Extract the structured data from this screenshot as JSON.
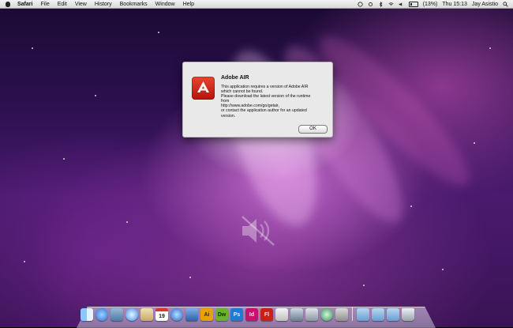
{
  "menubar": {
    "app_name": "Safari",
    "items": [
      "File",
      "Edit",
      "View",
      "History",
      "Bookmarks",
      "Window",
      "Help"
    ],
    "battery_text": "(13%)",
    "clock": "Thu 15:13",
    "user": "Jay Asistio"
  },
  "dialog": {
    "title": "Adobe AIR",
    "message_lines": [
      "This application requires a version of Adobe AIR",
      "which cannot be found.",
      "Please download the latest version of the runtime",
      "from",
      "http://www.adobe.com/go/getair,",
      "or contact the application author for an updated",
      "version."
    ],
    "ok_label": "OK"
  },
  "dock": {
    "calendar_day": "19",
    "app_labels": [
      "Ai",
      "Dw",
      "Ps",
      "Id",
      "Fl"
    ]
  },
  "colors": {
    "adobe_air_red": "#c8281a",
    "illustrator": "#e8a200",
    "dreamweaver": "#6bb22a",
    "photoshop": "#1f7ad1",
    "indesign": "#c4136f",
    "flash": "#c8201b"
  },
  "icons": [
    "apple-icon",
    "spotlight-icon",
    "wifi-icon",
    "volume-icon",
    "bluetooth-icon",
    "battery-icon",
    "adobe-air-icon",
    "mute-icon",
    "finder-icon",
    "safari-icon",
    "calendar-icon",
    "itunes-icon",
    "trash-icon"
  ]
}
